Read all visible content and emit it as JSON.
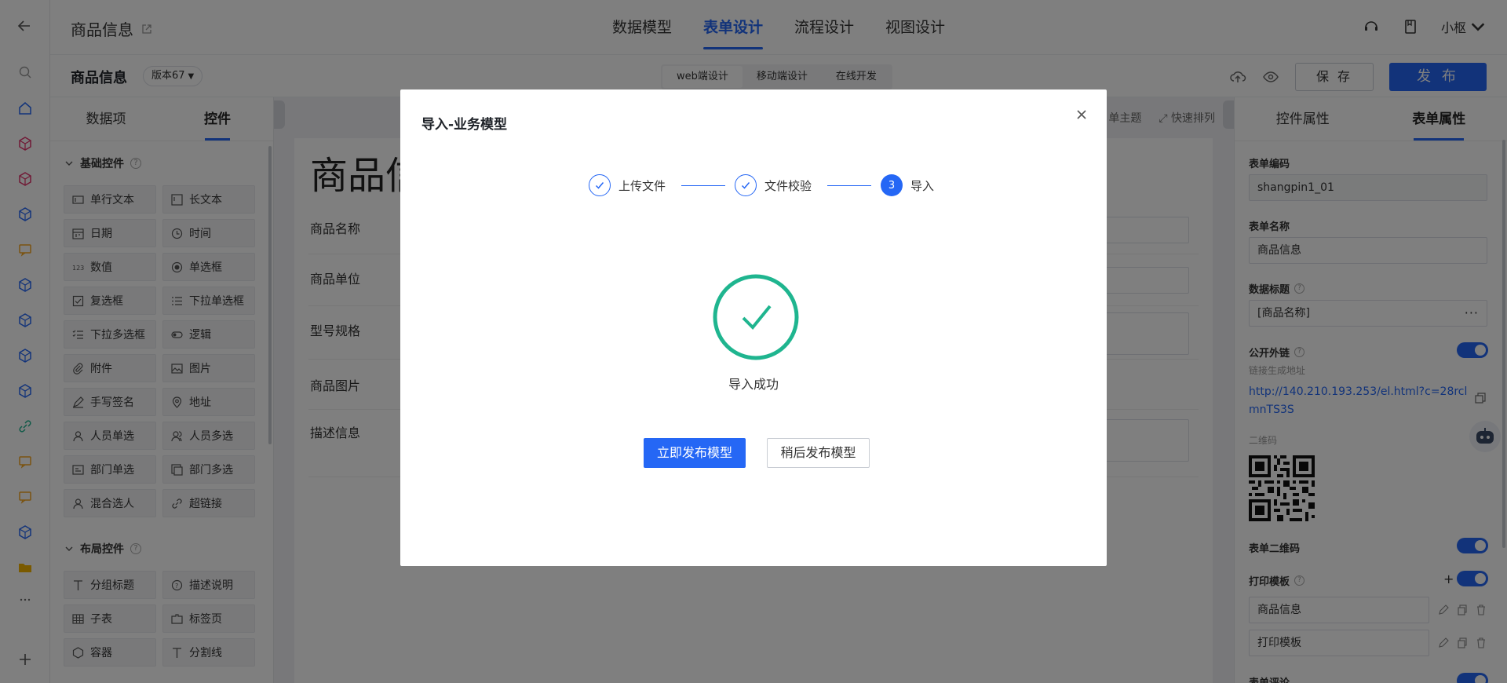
{
  "header": {
    "title": "商品信息",
    "tabs": [
      "数据模型",
      "表单设计",
      "流程设计",
      "视图设计"
    ],
    "active_tab": "表单设计",
    "user": "小枢"
  },
  "subheader": {
    "form_name": "商品信息",
    "version": "版本67",
    "segments": [
      "web端设计",
      "移动端设计",
      "在线开发"
    ],
    "save": "保 存",
    "publish": "发 布"
  },
  "left_panel": {
    "tabs": [
      "数据项",
      "控件"
    ],
    "basic_section": "基础控件",
    "basic_controls": [
      "单行文本",
      "长文本",
      "日期",
      "时间",
      "数值",
      "单选框",
      "复选框",
      "下拉单选框",
      "下拉多选框",
      "逻辑",
      "附件",
      "图片",
      "手写签名",
      "地址",
      "人员单选",
      "人员多选",
      "部门单选",
      "部门多选",
      "混合选人",
      "超链接"
    ],
    "layout_section": "布局控件",
    "layout_controls": [
      "分组标题",
      "描述说明",
      "子表",
      "标签页",
      "容器",
      "分割线"
    ]
  },
  "canvas": {
    "tools": [
      "单主题",
      "快速排列"
    ],
    "title": "商品信",
    "fields": [
      "商品名称",
      "商品单位",
      "型号规格",
      "商品图片",
      "描述信息"
    ]
  },
  "right_panel": {
    "tabs": [
      "控件属性",
      "表单属性"
    ],
    "form_code_label": "表单编码",
    "form_code": "shangpin1_01",
    "form_name_label": "表单名称",
    "form_name": "商品信息",
    "data_title_label": "数据标题",
    "data_title": "[商品名称]",
    "public_link_label": "公开外链",
    "link_hint": "链接生成地址",
    "link_url": "http://140.210.193.253/el.html?c=28rclmnTS3S",
    "qr_label": "二维码",
    "form_qr_label": "表单二维码",
    "print_label": "打印模板",
    "print_templates": [
      "商品信息",
      "打印模板"
    ],
    "comment_label": "表单评论"
  },
  "modal": {
    "title": "导入-业务模型",
    "steps": [
      {
        "label": "上传文件",
        "state": "done"
      },
      {
        "label": "文件校验",
        "state": "done"
      },
      {
        "label": "导入",
        "state": "current",
        "number": "3"
      }
    ],
    "result": "导入成功",
    "primary_button": "立即发布模型",
    "secondary_button": "稍后发布模型"
  },
  "colors": {
    "primary": "#2567f5",
    "success": "#1fb58f"
  }
}
